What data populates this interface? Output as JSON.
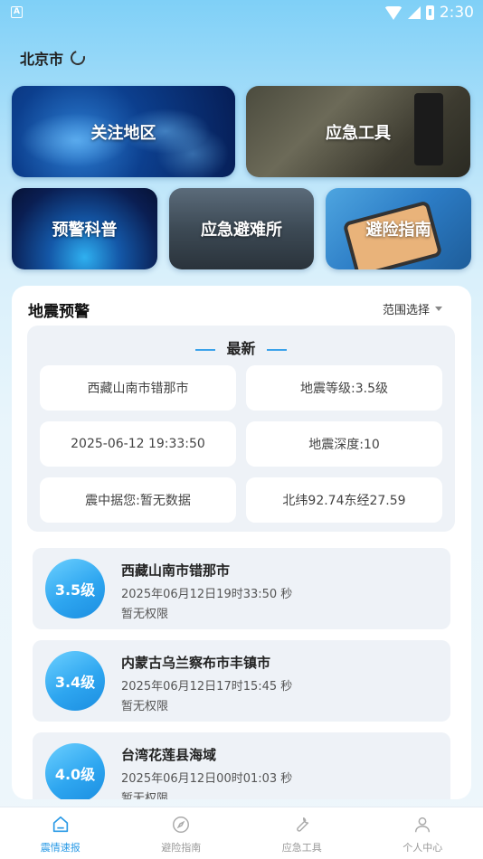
{
  "status_bar": {
    "time": "2:30",
    "app_badge": "A"
  },
  "location": {
    "city": "北京市"
  },
  "tiles": {
    "focus_area": "关注地区",
    "emergency_tools": "应急工具",
    "warning_science": "预警科普",
    "shelter": "应急避难所",
    "avoid_guide": "避险指南"
  },
  "card": {
    "title": "地震预警",
    "range_select": "范围选择",
    "latest": {
      "heading": "最新",
      "location": "西藏山南市错那市",
      "magnitude": "地震等级:3.5级",
      "time": "2025-06-12 19:33:50",
      "depth": "地震深度:10",
      "distance": "震中据您:暂无数据",
      "coords": "北纬92.74东经27.59"
    },
    "quakes": [
      {
        "magnitude": "3.5级",
        "location": "西藏山南市错那市",
        "time": "2025年06月12日19时33:50 秒",
        "permission": "暂无权限"
      },
      {
        "magnitude": "3.4级",
        "location": "内蒙古乌兰察布市丰镇市",
        "time": "2025年06月12日17时15:45 秒",
        "permission": "暂无权限"
      },
      {
        "magnitude": "4.0级",
        "location": "台湾花莲县海域",
        "time": "2025年06月12日00时01:03 秒",
        "permission": "暂无权限"
      }
    ]
  },
  "nav": {
    "items": [
      {
        "label": "震情速报",
        "icon": "home-icon",
        "active": true
      },
      {
        "label": "避险指南",
        "icon": "compass-icon",
        "active": false
      },
      {
        "label": "应急工具",
        "icon": "wrench-icon",
        "active": false
      },
      {
        "label": "个人中心",
        "icon": "person-icon",
        "active": false
      }
    ]
  },
  "colors": {
    "accent": "#2a9ae6",
    "magnitude_badge": "#2ea6f0"
  }
}
